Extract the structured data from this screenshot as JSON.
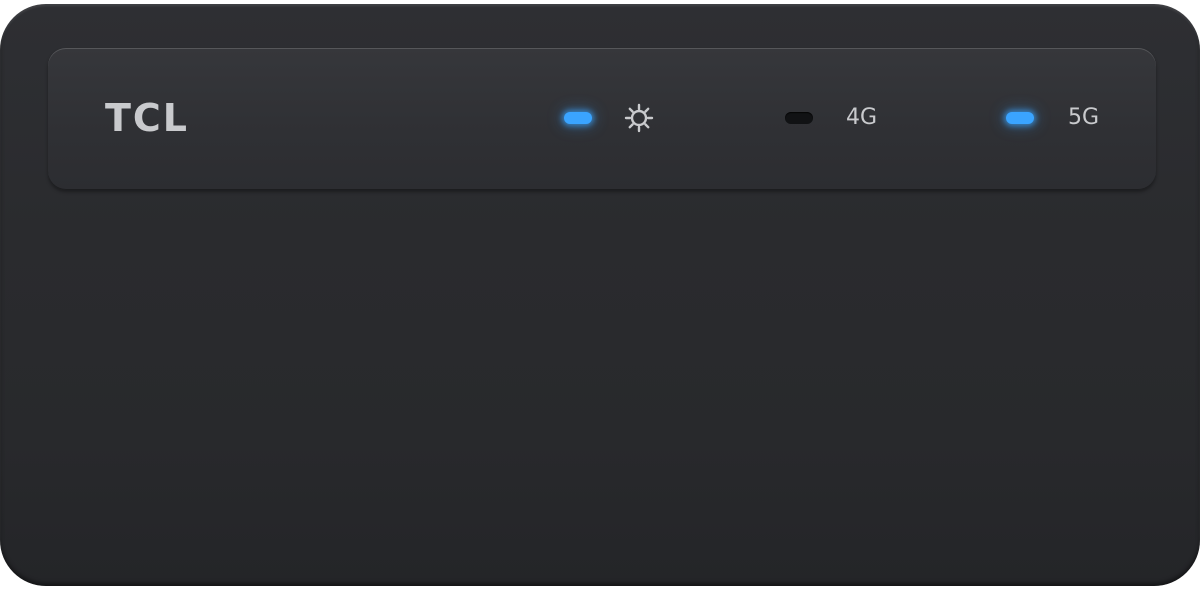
{
  "device": {
    "brand_logo": "TCL",
    "indicators": [
      {
        "name": "power",
        "icon": "gear-icon",
        "state": "on",
        "color": "#3aa4ff"
      },
      {
        "name": "4g",
        "label": "4G",
        "state": "off",
        "color": "#111214"
      },
      {
        "name": "5g",
        "label": "5G",
        "state": "on",
        "color": "#3aa4ff"
      }
    ]
  }
}
